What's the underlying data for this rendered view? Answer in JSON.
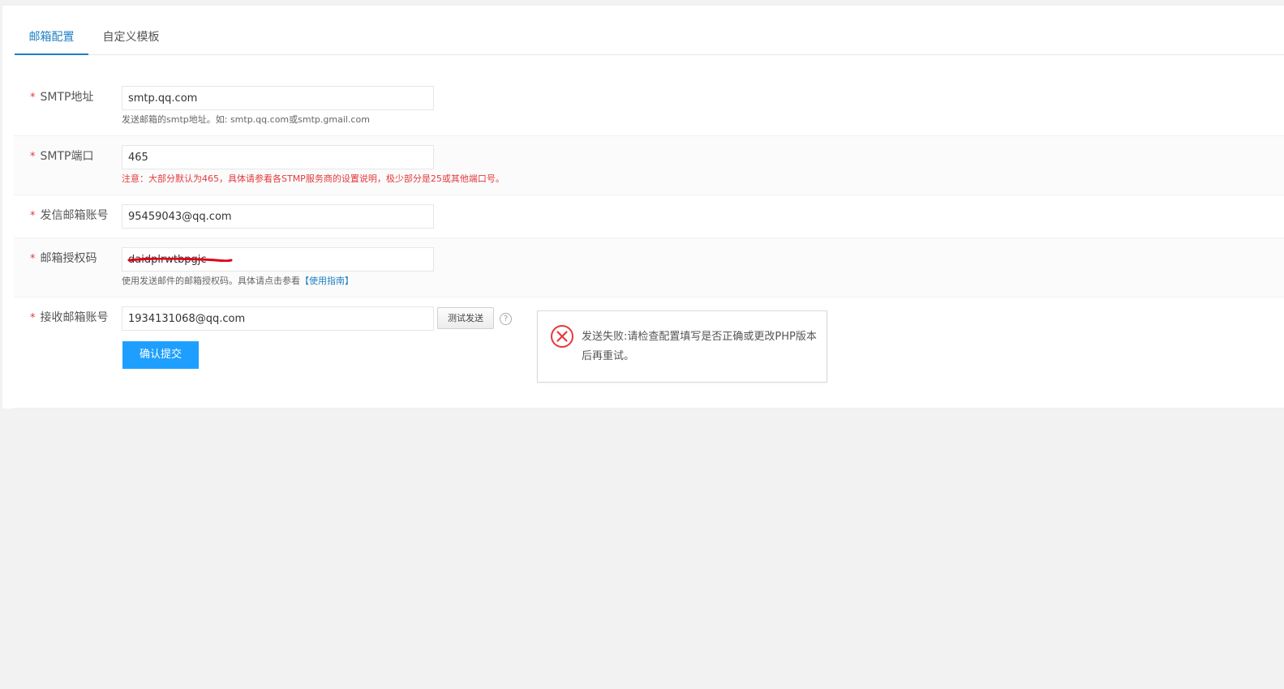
{
  "tabs": [
    {
      "label": "邮箱配置",
      "active": true
    },
    {
      "label": "自定义模板",
      "active": false
    }
  ],
  "required_mark": "*",
  "form": {
    "smtp_host": {
      "label": "SMTP地址",
      "value": "smtp.qq.com",
      "hint": "发送邮箱的smtp地址。如: smtp.qq.com或smtp.gmail.com"
    },
    "smtp_port": {
      "label": "SMTP端口",
      "value": "465",
      "hint": "注意：大部分默认为465，具体请参看各STMP服务商的设置说明，极少部分是25或其他端口号。"
    },
    "sender_account": {
      "label": "发信邮箱账号",
      "value": "95459043@qq.com"
    },
    "auth_code": {
      "label": "邮箱授权码",
      "value": "daidplrwtbpgjc",
      "hint": "使用发送邮件的邮箱授权码。具体请点击参看",
      "hint_link": "【使用指南】"
    },
    "receiver_account": {
      "label": "接收邮箱账号",
      "value": "1934131068@qq.com"
    }
  },
  "buttons": {
    "test_send": "测试发送",
    "help": "?",
    "submit": "确认提交"
  },
  "alert": {
    "icon": "error-circle-x-icon",
    "message": "发送失败:请检查配置填写是否正确或更改PHP版本后再重试。"
  },
  "colors": {
    "accent": "#1e7fc4",
    "primary_button": "#1e9fff",
    "error": "#e4393c"
  }
}
